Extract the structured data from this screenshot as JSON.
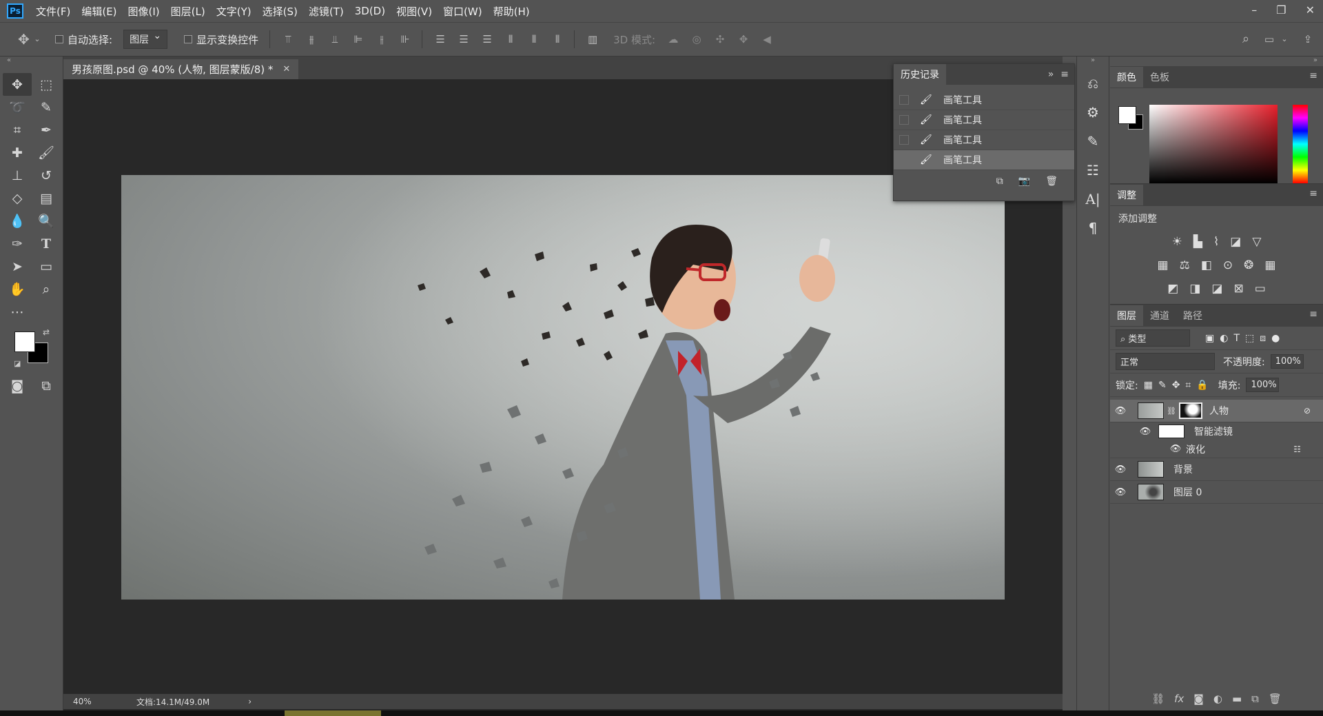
{
  "app": {
    "logo": "Ps",
    "menu": [
      "文件(F)",
      "编辑(E)",
      "图像(I)",
      "图层(L)",
      "文字(Y)",
      "选择(S)",
      "滤镜(T)",
      "3D(D)",
      "视图(V)",
      "窗口(W)",
      "帮助(H)"
    ]
  },
  "options": {
    "auto_select_label": "自动选择:",
    "auto_select_value": "图层",
    "show_transform_label": "显示变换控件",
    "mode_3d_label": "3D 模式:"
  },
  "document": {
    "tab_title": "男孩原图.psd @ 40% (人物, 图层蒙版/8) *",
    "zoom": "40%",
    "doc_info": "文档:14.1M/49.0M"
  },
  "history": {
    "title": "历史记录",
    "items": [
      "画笔工具",
      "画笔工具",
      "画笔工具",
      "画笔工具"
    ]
  },
  "color_panel": {
    "tabs": [
      "颜色",
      "色板"
    ],
    "foreground": "#ffffff",
    "background": "#000000"
  },
  "adjust_panel": {
    "title": "调整",
    "add_label": "添加调整"
  },
  "layers_panel": {
    "tabs": [
      "图层",
      "通道",
      "路径"
    ],
    "filter_type": "类型",
    "blend_mode": "正常",
    "opacity_label": "不透明度:",
    "opacity_value": "100%",
    "lock_label": "锁定:",
    "fill_label": "填充:",
    "fill_value": "100%",
    "layers": [
      {
        "name": "人物"
      },
      {
        "name": "智能滤镜"
      },
      {
        "name": "液化"
      },
      {
        "name": "背景"
      },
      {
        "name": "图层 0"
      }
    ]
  }
}
